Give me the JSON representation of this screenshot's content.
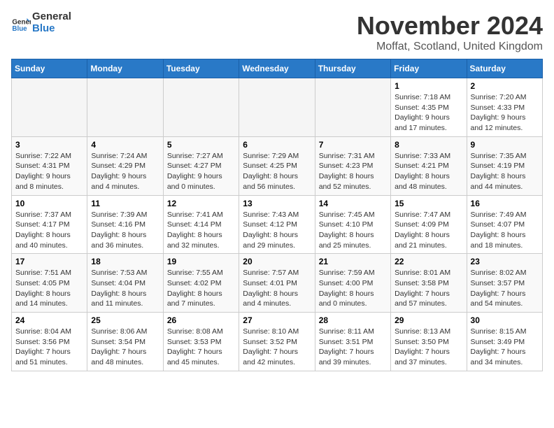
{
  "header": {
    "logo_line1": "General",
    "logo_line2": "Blue",
    "month_title": "November 2024",
    "location": "Moffat, Scotland, United Kingdom"
  },
  "weekdays": [
    "Sunday",
    "Monday",
    "Tuesday",
    "Wednesday",
    "Thursday",
    "Friday",
    "Saturday"
  ],
  "weeks": [
    [
      {
        "day": "",
        "info": ""
      },
      {
        "day": "",
        "info": ""
      },
      {
        "day": "",
        "info": ""
      },
      {
        "day": "",
        "info": ""
      },
      {
        "day": "",
        "info": ""
      },
      {
        "day": "1",
        "info": "Sunrise: 7:18 AM\nSunset: 4:35 PM\nDaylight: 9 hours and 17 minutes."
      },
      {
        "day": "2",
        "info": "Sunrise: 7:20 AM\nSunset: 4:33 PM\nDaylight: 9 hours and 12 minutes."
      }
    ],
    [
      {
        "day": "3",
        "info": "Sunrise: 7:22 AM\nSunset: 4:31 PM\nDaylight: 9 hours and 8 minutes."
      },
      {
        "day": "4",
        "info": "Sunrise: 7:24 AM\nSunset: 4:29 PM\nDaylight: 9 hours and 4 minutes."
      },
      {
        "day": "5",
        "info": "Sunrise: 7:27 AM\nSunset: 4:27 PM\nDaylight: 9 hours and 0 minutes."
      },
      {
        "day": "6",
        "info": "Sunrise: 7:29 AM\nSunset: 4:25 PM\nDaylight: 8 hours and 56 minutes."
      },
      {
        "day": "7",
        "info": "Sunrise: 7:31 AM\nSunset: 4:23 PM\nDaylight: 8 hours and 52 minutes."
      },
      {
        "day": "8",
        "info": "Sunrise: 7:33 AM\nSunset: 4:21 PM\nDaylight: 8 hours and 48 minutes."
      },
      {
        "day": "9",
        "info": "Sunrise: 7:35 AM\nSunset: 4:19 PM\nDaylight: 8 hours and 44 minutes."
      }
    ],
    [
      {
        "day": "10",
        "info": "Sunrise: 7:37 AM\nSunset: 4:17 PM\nDaylight: 8 hours and 40 minutes."
      },
      {
        "day": "11",
        "info": "Sunrise: 7:39 AM\nSunset: 4:16 PM\nDaylight: 8 hours and 36 minutes."
      },
      {
        "day": "12",
        "info": "Sunrise: 7:41 AM\nSunset: 4:14 PM\nDaylight: 8 hours and 32 minutes."
      },
      {
        "day": "13",
        "info": "Sunrise: 7:43 AM\nSunset: 4:12 PM\nDaylight: 8 hours and 29 minutes."
      },
      {
        "day": "14",
        "info": "Sunrise: 7:45 AM\nSunset: 4:10 PM\nDaylight: 8 hours and 25 minutes."
      },
      {
        "day": "15",
        "info": "Sunrise: 7:47 AM\nSunset: 4:09 PM\nDaylight: 8 hours and 21 minutes."
      },
      {
        "day": "16",
        "info": "Sunrise: 7:49 AM\nSunset: 4:07 PM\nDaylight: 8 hours and 18 minutes."
      }
    ],
    [
      {
        "day": "17",
        "info": "Sunrise: 7:51 AM\nSunset: 4:05 PM\nDaylight: 8 hours and 14 minutes."
      },
      {
        "day": "18",
        "info": "Sunrise: 7:53 AM\nSunset: 4:04 PM\nDaylight: 8 hours and 11 minutes."
      },
      {
        "day": "19",
        "info": "Sunrise: 7:55 AM\nSunset: 4:02 PM\nDaylight: 8 hours and 7 minutes."
      },
      {
        "day": "20",
        "info": "Sunrise: 7:57 AM\nSunset: 4:01 PM\nDaylight: 8 hours and 4 minutes."
      },
      {
        "day": "21",
        "info": "Sunrise: 7:59 AM\nSunset: 4:00 PM\nDaylight: 8 hours and 0 minutes."
      },
      {
        "day": "22",
        "info": "Sunrise: 8:01 AM\nSunset: 3:58 PM\nDaylight: 7 hours and 57 minutes."
      },
      {
        "day": "23",
        "info": "Sunrise: 8:02 AM\nSunset: 3:57 PM\nDaylight: 7 hours and 54 minutes."
      }
    ],
    [
      {
        "day": "24",
        "info": "Sunrise: 8:04 AM\nSunset: 3:56 PM\nDaylight: 7 hours and 51 minutes."
      },
      {
        "day": "25",
        "info": "Sunrise: 8:06 AM\nSunset: 3:54 PM\nDaylight: 7 hours and 48 minutes."
      },
      {
        "day": "26",
        "info": "Sunrise: 8:08 AM\nSunset: 3:53 PM\nDaylight: 7 hours and 45 minutes."
      },
      {
        "day": "27",
        "info": "Sunrise: 8:10 AM\nSunset: 3:52 PM\nDaylight: 7 hours and 42 minutes."
      },
      {
        "day": "28",
        "info": "Sunrise: 8:11 AM\nSunset: 3:51 PM\nDaylight: 7 hours and 39 minutes."
      },
      {
        "day": "29",
        "info": "Sunrise: 8:13 AM\nSunset: 3:50 PM\nDaylight: 7 hours and 37 minutes."
      },
      {
        "day": "30",
        "info": "Sunrise: 8:15 AM\nSunset: 3:49 PM\nDaylight: 7 hours and 34 minutes."
      }
    ]
  ]
}
